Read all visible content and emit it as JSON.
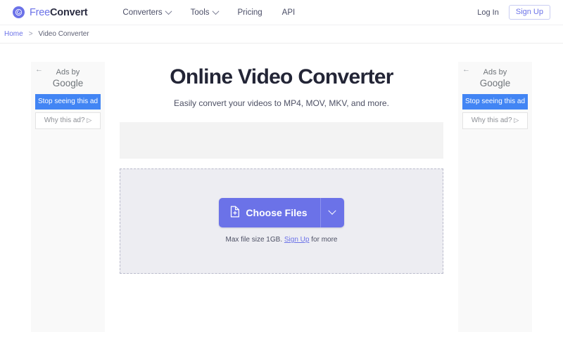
{
  "header": {
    "brand": {
      "light": "Free",
      "bold": "Convert",
      "logo_icon": "circle-swirl-icon"
    },
    "nav": [
      {
        "label": "Converters",
        "has_caret": true
      },
      {
        "label": "Tools",
        "has_caret": true
      },
      {
        "label": "Pricing",
        "has_caret": false
      },
      {
        "label": "API",
        "has_caret": false
      }
    ],
    "login_label": "Log In",
    "signup_label": "Sign Up"
  },
  "breadcrumb": {
    "home": "Home",
    "separator": ">",
    "current": "Video Converter"
  },
  "ads": {
    "back_arrow": "←",
    "ads_by_line1": "Ads by",
    "ads_by_line2": "Google",
    "stop_label": "Stop seeing this ad",
    "why_label": "Why this ad?",
    "why_triangle": "▷",
    "blue": "#4285f4",
    "panel_bg": "#f9f9f9"
  },
  "main": {
    "title": "Online Video Converter",
    "subtitle": "Easily convert your videos to MP4, MOV, MKV, and more.",
    "choose_files_label": "Choose Files",
    "choose_files_icon": "file-plus-icon",
    "caret_icon": "chevron-down-icon",
    "max_file_prefix": "Max file size 1GB.",
    "max_file_link": "Sign Up",
    "max_file_suffix": "for more",
    "accent": "#6b72e8",
    "dropzone_bg": "#ededf2",
    "ad_banner_bg": "#f3f3f3"
  }
}
